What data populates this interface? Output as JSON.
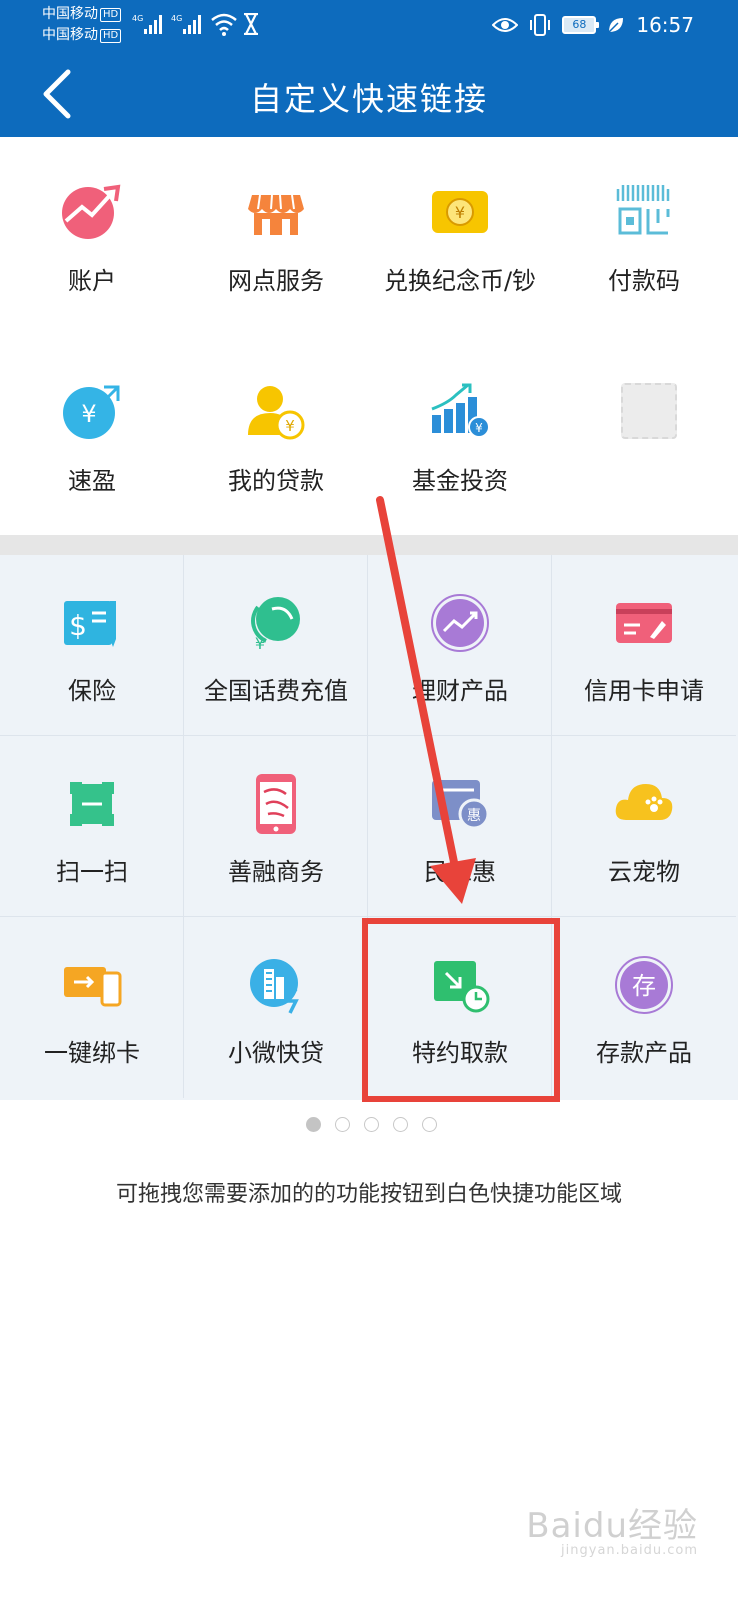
{
  "status_bar": {
    "carrier1": "中国移动",
    "carrier2": "中国移动",
    "hd": "HD",
    "net1": "4G",
    "net2": "4G",
    "battery": "68",
    "time": "16:57"
  },
  "header": {
    "title": "自定义快速链接"
  },
  "quick_links": [
    {
      "label": "账户",
      "icon": "account-trend-icon"
    },
    {
      "label": "网点服务",
      "icon": "store-icon"
    },
    {
      "label": "兑换纪念币/钞",
      "icon": "coin-card-icon"
    },
    {
      "label": "付款码",
      "icon": "payment-code-icon"
    },
    {
      "label": "速盈",
      "icon": "yuan-growth-icon"
    },
    {
      "label": "我的贷款",
      "icon": "user-loan-icon"
    },
    {
      "label": "基金投资",
      "icon": "fund-chart-icon"
    }
  ],
  "functions": [
    {
      "label": "保险",
      "icon": "insurance-doc-icon"
    },
    {
      "label": "全国话费充值",
      "icon": "phone-recharge-icon"
    },
    {
      "label": "理财产品",
      "icon": "wealth-product-icon"
    },
    {
      "label": "信用卡申请",
      "icon": "credit-card-icon"
    },
    {
      "label": "扫一扫",
      "icon": "scan-icon"
    },
    {
      "label": "善融商务",
      "icon": "shanrong-phone-icon"
    },
    {
      "label": "民工惠",
      "icon": "workers-benefit-icon"
    },
    {
      "label": "云宠物",
      "icon": "cloud-pet-icon"
    },
    {
      "label": "一键绑卡",
      "icon": "bind-card-icon"
    },
    {
      "label": "小微快贷",
      "icon": "micro-loan-icon"
    },
    {
      "label": "特约取款",
      "icon": "special-withdrawal-icon"
    },
    {
      "label": "存款产品",
      "icon": "deposit-product-icon"
    }
  ],
  "pager": {
    "pages": 5,
    "current": 1
  },
  "hint": "可拖拽您需要添加的的功能按钮到白色快捷功能区域",
  "watermark": {
    "text": "Baidu经验",
    "sub": "jingyan.baidu.com"
  },
  "colors": {
    "header_blue": "#0d6bbd",
    "annotation_red": "#e8433a"
  }
}
